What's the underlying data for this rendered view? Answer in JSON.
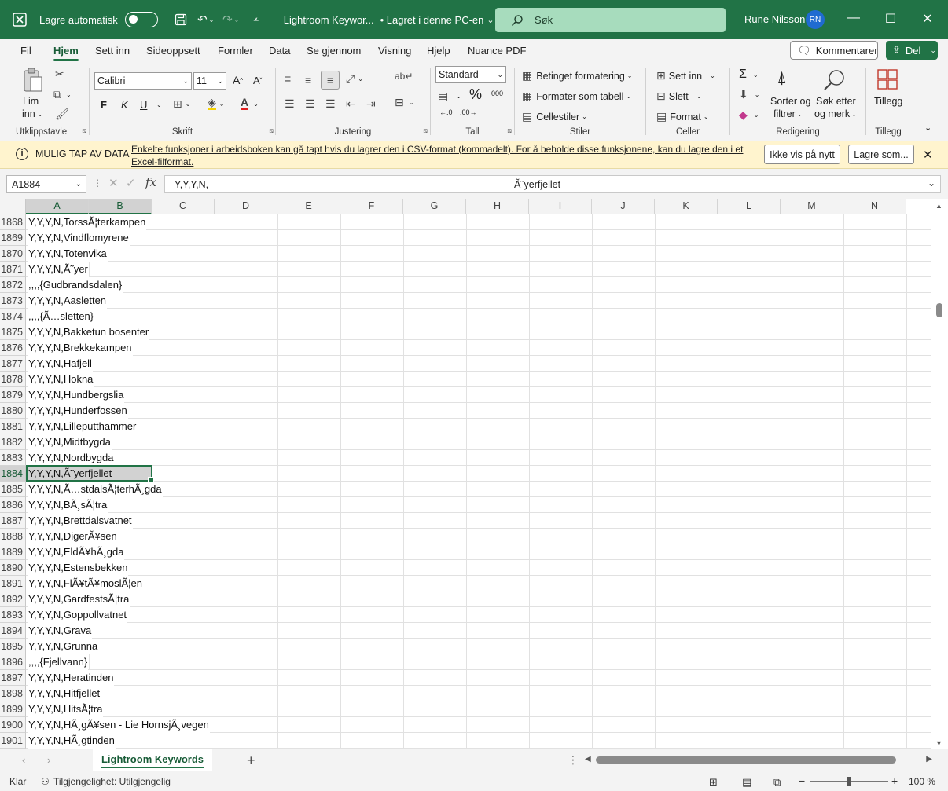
{
  "title_bar": {
    "autosave_label": "Lagre automatisk",
    "file_title": "Lightroom Keywor...",
    "saved_status": "• Lagret i denne PC-en",
    "search_placeholder": "Søk",
    "user_name": "Rune Nilsson",
    "user_initials": "RN"
  },
  "menu_tabs": [
    "Fil",
    "Hjem",
    "Sett inn",
    "Sideoppsett",
    "Formler",
    "Data",
    "Se gjennom",
    "Visning",
    "Hjelp",
    "Nuance PDF"
  ],
  "active_tab": "Hjem",
  "menu_actions": {
    "comments": "Kommentarer",
    "share": "Del"
  },
  "ribbon": {
    "clipboard": {
      "label": "Utklippstavle",
      "paste_line1": "Lim",
      "paste_line2": "inn"
    },
    "font": {
      "label": "Skrift",
      "font_name": "Calibri",
      "font_size": "11",
      "bold": "F",
      "italic": "K",
      "underline": "U"
    },
    "alignment": {
      "label": "Justering"
    },
    "number": {
      "label": "Tall",
      "format": "Standard"
    },
    "styles": {
      "label": "Stiler",
      "conditional": "Betinget formatering",
      "as_table": "Formater som tabell",
      "cell_styles": "Cellestiler"
    },
    "cells": {
      "label": "Celler",
      "insert": "Sett inn",
      "delete": "Slett",
      "format": "Format"
    },
    "editing": {
      "label": "Redigering",
      "sort_line1": "Sorter og",
      "sort_line2": "filtrer",
      "find_line1": "Søk etter",
      "find_line2": "og merk"
    },
    "addins": {
      "label": "Tillegg",
      "button": "Tillegg"
    }
  },
  "infobar": {
    "title": "MULIG TAP AV DATA",
    "message": "Enkelte funksjoner i arbeidsboken kan gå tapt hvis du lagrer den i CSV-format (kommadelt). For å beholde disse funksjonene, kan du lagre den i et Excel-filformat.",
    "dont_show": "Ikke vis på nytt",
    "save_as": "Lagre som..."
  },
  "formula_bar": {
    "name_box": "A1884",
    "value_part1": "Y,Y,Y,N,",
    "value_part2": "Ã˜yerfjellet"
  },
  "columns": [
    "A",
    "B",
    "C",
    "D",
    "E",
    "F",
    "G",
    "H",
    "I",
    "J",
    "K",
    "L",
    "M",
    "N"
  ],
  "selected_row": "1884",
  "rows": [
    {
      "n": "1868",
      "a": "Y,Y,Y,N,TorssÃ¦terkampen"
    },
    {
      "n": "1869",
      "a": "Y,Y,Y,N,Vindflomyrene"
    },
    {
      "n": "1870",
      "a": "Y,Y,Y,N,Totenvika"
    },
    {
      "n": "1871",
      "a": "Y,Y,Y,N,Ã˜yer"
    },
    {
      "n": "1872",
      "a": ",,,,{Gudbrandsdalen}"
    },
    {
      "n": "1873",
      "a": "Y,Y,Y,N,Aasletten"
    },
    {
      "n": "1874",
      "a": ",,,,{Ã…sletten}"
    },
    {
      "n": "1875",
      "a": "Y,Y,Y,N,Bakketun bosenter"
    },
    {
      "n": "1876",
      "a": "Y,Y,Y,N,Brekkekampen"
    },
    {
      "n": "1877",
      "a": "Y,Y,Y,N,Hafjell"
    },
    {
      "n": "1878",
      "a": "Y,Y,Y,N,Hokna"
    },
    {
      "n": "1879",
      "a": "Y,Y,Y,N,Hundbergslia"
    },
    {
      "n": "1880",
      "a": "Y,Y,Y,N,Hunderfossen"
    },
    {
      "n": "1881",
      "a": "Y,Y,Y,N,Lilleputthammer"
    },
    {
      "n": "1882",
      "a": "Y,Y,Y,N,Midtbygda"
    },
    {
      "n": "1883",
      "a": "Y,Y,Y,N,Nordbygda"
    },
    {
      "n": "1884",
      "a": "Y,Y,Y,N,Ã˜yerfjellet"
    },
    {
      "n": "1885",
      "a": "Y,Y,Y,N,Ã…stdalsÃ¦terhÃ¸gda"
    },
    {
      "n": "1886",
      "a": "Y,Y,Y,N,BÃ¸sÃ¦tra"
    },
    {
      "n": "1887",
      "a": "Y,Y,Y,N,Brettdalsvatnet"
    },
    {
      "n": "1888",
      "a": "Y,Y,Y,N,DigerÃ¥sen"
    },
    {
      "n": "1889",
      "a": "Y,Y,Y,N,EldÃ¥hÃ¸gda"
    },
    {
      "n": "1890",
      "a": "Y,Y,Y,N,Estensbekken"
    },
    {
      "n": "1891",
      "a": "Y,Y,Y,N,FlÃ¥tÃ¥moslÃ¦en"
    },
    {
      "n": "1892",
      "a": "Y,Y,Y,N,GardfestsÃ¦tra"
    },
    {
      "n": "1893",
      "a": "Y,Y,Y,N,Goppollvatnet"
    },
    {
      "n": "1894",
      "a": "Y,Y,Y,N,Grava"
    },
    {
      "n": "1895",
      "a": "Y,Y,Y,N,Grunna"
    },
    {
      "n": "1896",
      "a": ",,,,{Fjellvann}"
    },
    {
      "n": "1897",
      "a": "Y,Y,Y,N,Heratinden"
    },
    {
      "n": "1898",
      "a": "Y,Y,Y,N,Hitfjellet"
    },
    {
      "n": "1899",
      "a": "Y,Y,Y,N,HitsÃ¦tra"
    },
    {
      "n": "1900",
      "a": "Y,Y,Y,N,HÃ¸gÃ¥sen - Lie HornsjÃ¸vegen"
    },
    {
      "n": "1901",
      "a": "Y,Y,Y,N,HÃ¸gtinden"
    }
  ],
  "sheet_tab": "Lightroom Keywords",
  "status_bar": {
    "ready": "Klar",
    "accessibility": "Tilgjengelighet: Utilgjengelig",
    "zoom": "100 %"
  }
}
